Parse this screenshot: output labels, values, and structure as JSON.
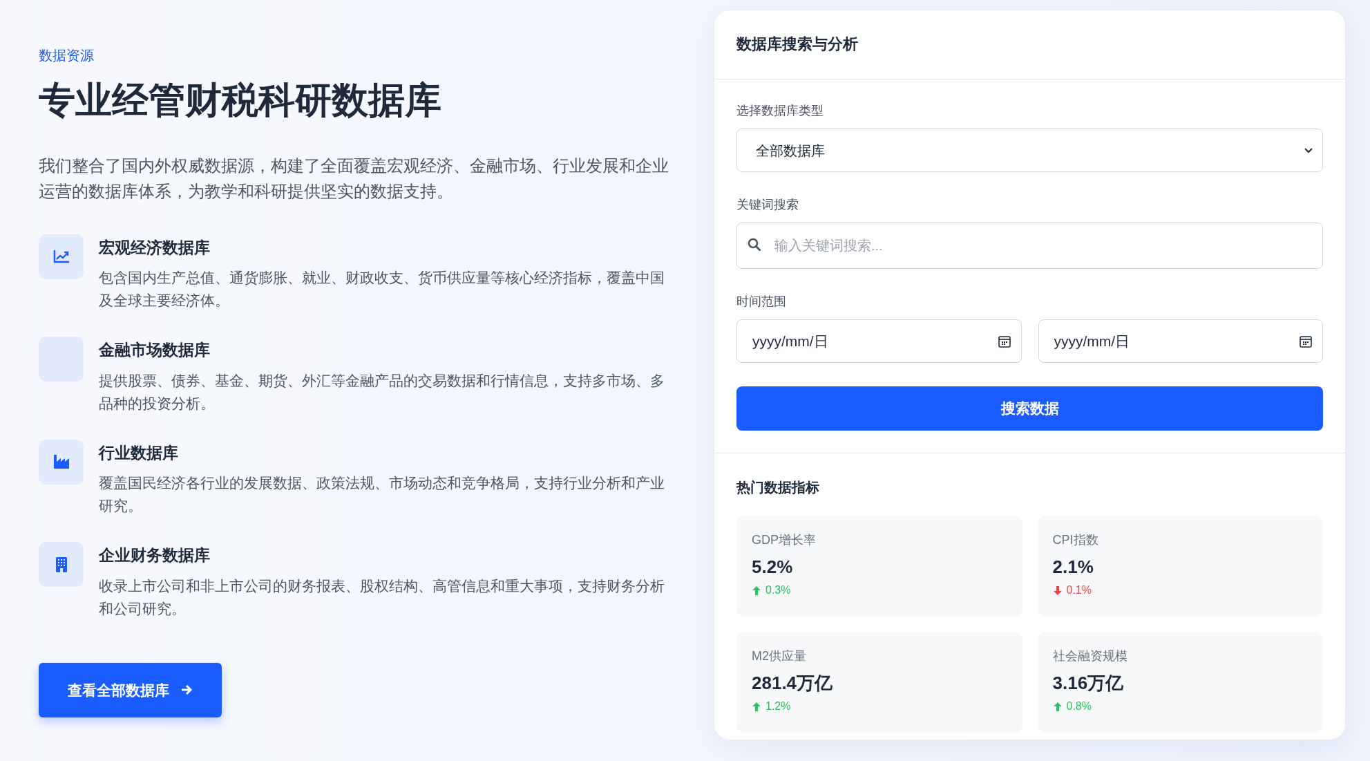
{
  "hero": {
    "eyebrow": "数据资源",
    "title": "专业经管财税科研数据库",
    "intro": "我们整合了国内外权威数据源，构建了全面覆盖宏观经济、金融市场、行业发展和企业运营的数据库体系，为教学和科研提供坚实的数据支持。",
    "features": [
      {
        "kind": "trend",
        "title": "宏观经济数据库",
        "text": "包含国内生产总值、通货膨胀、就业、财政收支、货币供应量等核心经济指标，覆盖中国及全球主要经济体。"
      },
      {
        "kind": "blank",
        "title": "金融市场数据库",
        "text": "提供股票、债券、基金、期货、外汇等金融产品的交易数据和行情信息，支持多市场、多品种的投资分析。"
      },
      {
        "kind": "factory",
        "title": "行业数据库",
        "text": "覆盖国民经济各行业的发展数据、政策法规、市场动态和竞争格局，支持行业分析和产业研究。"
      },
      {
        "kind": "building",
        "title": "企业财务数据库",
        "text": "收录上市公司和非上市公司的财务报表、股权结构、高管信息和重大事项，支持财务分析和公司研究。"
      }
    ],
    "button": "查看全部数据库"
  },
  "panel": {
    "title": "数据库搜索与分析",
    "type_label": "选择数据库类型",
    "type_value": "全部数据库",
    "keyword_label": "关键词搜索",
    "keyword_placeholder": "输入关键词搜索...",
    "range_label": "时间范围",
    "date_from": "yyyy/mm/日",
    "date_to": "yyyy/mm/日",
    "search_button": "搜索数据",
    "stats_title": "热门数据指标",
    "stats": [
      {
        "label": "GDP增长率",
        "value": "5.2%",
        "rising": true,
        "change": "0.3%"
      },
      {
        "label": "CPI指数",
        "value": "2.1%",
        "rising": false,
        "change": "0.1%"
      },
      {
        "label": "M2供应量",
        "value": "281.4万亿",
        "rising": true,
        "change": "1.2%"
      },
      {
        "label": "社会融资规模",
        "value": "3.16万亿",
        "rising": true,
        "change": "0.8%"
      }
    ]
  }
}
